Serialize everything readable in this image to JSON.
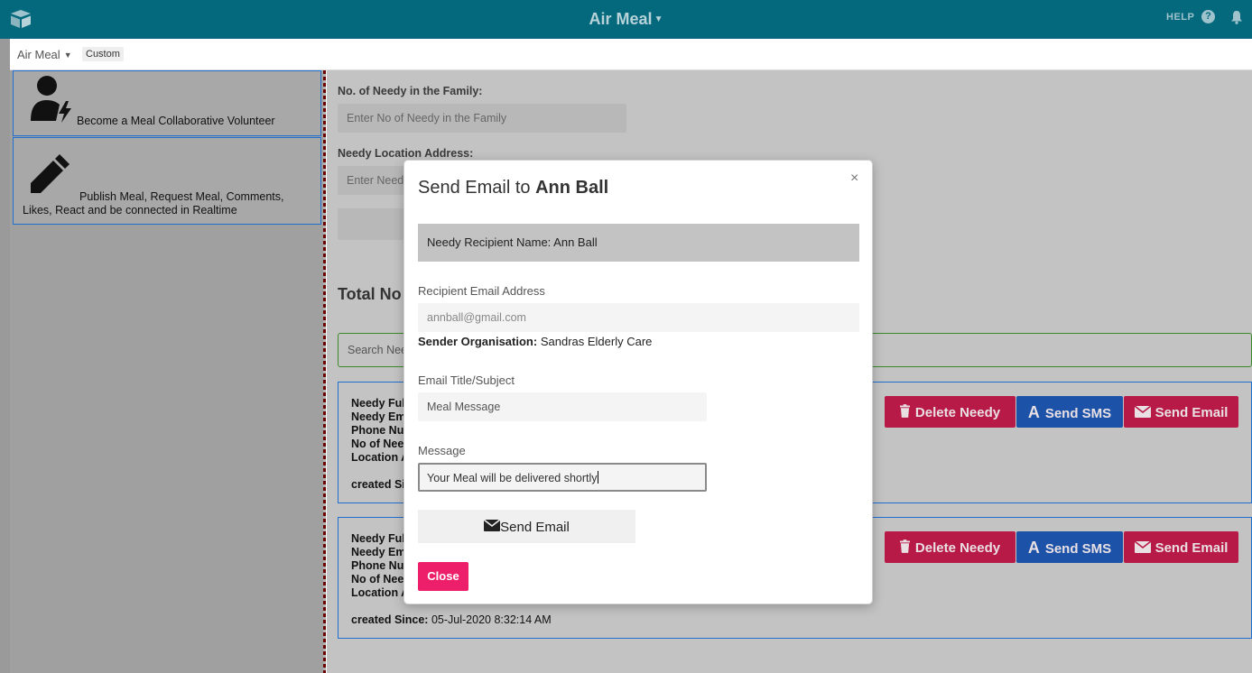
{
  "topbar": {
    "title": "Air Meal",
    "help": "HELP",
    "help_icon": "?"
  },
  "subbar": {
    "view": "Air Meal",
    "tag": "Custom"
  },
  "sidebar": {
    "cards": [
      {
        "icon": "user-bolt-icon",
        "text": "Become a Meal Collaborative Volunteer"
      },
      {
        "icon": "pencil-icon",
        "text_line1": "Publish Meal, Request Meal, Comments,",
        "text_line2": "Likes, React and be connected in Realtime"
      }
    ]
  },
  "form": {
    "needy_count_label": "No. of Needy in the Family:",
    "needy_count_placeholder": "Enter No of Needy in the Family",
    "address_label": "Needy Location Address:",
    "address_placeholder": "Enter Needy"
  },
  "main": {
    "heading": "Total No",
    "search_placeholder": "Search Nee",
    "cards": [
      {
        "lines": [
          "Needy Ful",
          "Needy Em",
          "Phone Nu",
          "No of Nee",
          "Location A"
        ],
        "created_label": "created Sinc",
        "created_value": ""
      },
      {
        "lines": [
          "Needy Ful",
          "Needy Em",
          "Phone Nu",
          "No of Nee",
          "Location A"
        ],
        "created_label": "created Since:",
        "created_value": "05-Jul-2020 8:32:14 AM"
      }
    ],
    "actions": {
      "delete": "Delete Needy",
      "sms": "Send SMS",
      "email": "Send Email"
    }
  },
  "modal": {
    "title_prefix": "Send Email to",
    "title_name": "Ann Ball",
    "close_x": "×",
    "recipient_bar": "Needy Recipient Name: Ann Ball",
    "email_label": "Recipient Email Address",
    "email_value": "annball@gmail.com",
    "sender_label": "Sender Organisation:",
    "sender_value": "Sandras Elderly Care",
    "subject_label": "Email Title/Subject",
    "subject_value": "Meal Message",
    "message_label": "Message",
    "message_value": "Your Meal will be delivered shortly",
    "send_button": "Send Email",
    "close_button": "Close"
  },
  "colors": {
    "topbar": "#05697e",
    "danger": "#b81a47",
    "primary": "#1c52a8",
    "close": "#ed1f6a"
  }
}
